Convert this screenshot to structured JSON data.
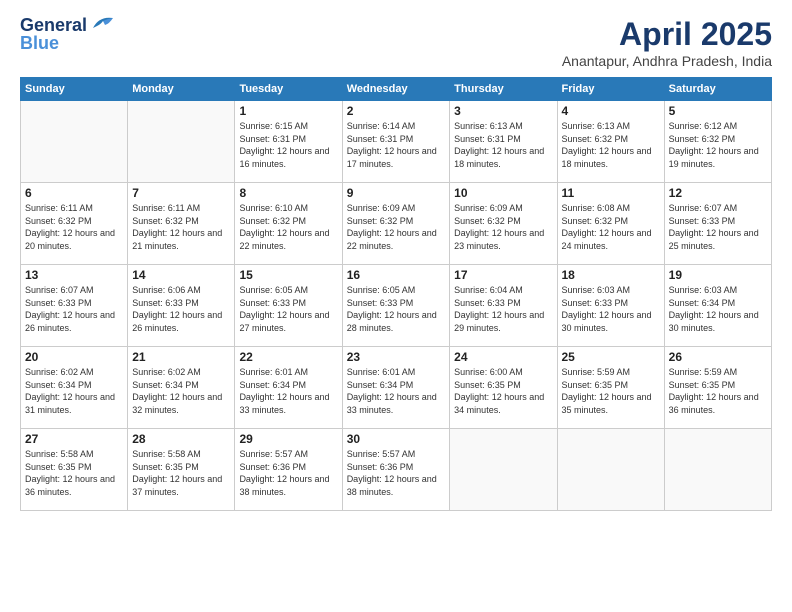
{
  "header": {
    "logo_line1": "General",
    "logo_line2": "Blue",
    "month_title": "April 2025",
    "location": "Anantapur, Andhra Pradesh, India"
  },
  "weekdays": [
    "Sunday",
    "Monday",
    "Tuesday",
    "Wednesday",
    "Thursday",
    "Friday",
    "Saturday"
  ],
  "weeks": [
    [
      {
        "day": "",
        "sunrise": "",
        "sunset": "",
        "daylight": ""
      },
      {
        "day": "",
        "sunrise": "",
        "sunset": "",
        "daylight": ""
      },
      {
        "day": "1",
        "sunrise": "Sunrise: 6:15 AM",
        "sunset": "Sunset: 6:31 PM",
        "daylight": "Daylight: 12 hours and 16 minutes."
      },
      {
        "day": "2",
        "sunrise": "Sunrise: 6:14 AM",
        "sunset": "Sunset: 6:31 PM",
        "daylight": "Daylight: 12 hours and 17 minutes."
      },
      {
        "day": "3",
        "sunrise": "Sunrise: 6:13 AM",
        "sunset": "Sunset: 6:31 PM",
        "daylight": "Daylight: 12 hours and 18 minutes."
      },
      {
        "day": "4",
        "sunrise": "Sunrise: 6:13 AM",
        "sunset": "Sunset: 6:32 PM",
        "daylight": "Daylight: 12 hours and 18 minutes."
      },
      {
        "day": "5",
        "sunrise": "Sunrise: 6:12 AM",
        "sunset": "Sunset: 6:32 PM",
        "daylight": "Daylight: 12 hours and 19 minutes."
      }
    ],
    [
      {
        "day": "6",
        "sunrise": "Sunrise: 6:11 AM",
        "sunset": "Sunset: 6:32 PM",
        "daylight": "Daylight: 12 hours and 20 minutes."
      },
      {
        "day": "7",
        "sunrise": "Sunrise: 6:11 AM",
        "sunset": "Sunset: 6:32 PM",
        "daylight": "Daylight: 12 hours and 21 minutes."
      },
      {
        "day": "8",
        "sunrise": "Sunrise: 6:10 AM",
        "sunset": "Sunset: 6:32 PM",
        "daylight": "Daylight: 12 hours and 22 minutes."
      },
      {
        "day": "9",
        "sunrise": "Sunrise: 6:09 AM",
        "sunset": "Sunset: 6:32 PM",
        "daylight": "Daylight: 12 hours and 22 minutes."
      },
      {
        "day": "10",
        "sunrise": "Sunrise: 6:09 AM",
        "sunset": "Sunset: 6:32 PM",
        "daylight": "Daylight: 12 hours and 23 minutes."
      },
      {
        "day": "11",
        "sunrise": "Sunrise: 6:08 AM",
        "sunset": "Sunset: 6:32 PM",
        "daylight": "Daylight: 12 hours and 24 minutes."
      },
      {
        "day": "12",
        "sunrise": "Sunrise: 6:07 AM",
        "sunset": "Sunset: 6:33 PM",
        "daylight": "Daylight: 12 hours and 25 minutes."
      }
    ],
    [
      {
        "day": "13",
        "sunrise": "Sunrise: 6:07 AM",
        "sunset": "Sunset: 6:33 PM",
        "daylight": "Daylight: 12 hours and 26 minutes."
      },
      {
        "day": "14",
        "sunrise": "Sunrise: 6:06 AM",
        "sunset": "Sunset: 6:33 PM",
        "daylight": "Daylight: 12 hours and 26 minutes."
      },
      {
        "day": "15",
        "sunrise": "Sunrise: 6:05 AM",
        "sunset": "Sunset: 6:33 PM",
        "daylight": "Daylight: 12 hours and 27 minutes."
      },
      {
        "day": "16",
        "sunrise": "Sunrise: 6:05 AM",
        "sunset": "Sunset: 6:33 PM",
        "daylight": "Daylight: 12 hours and 28 minutes."
      },
      {
        "day": "17",
        "sunrise": "Sunrise: 6:04 AM",
        "sunset": "Sunset: 6:33 PM",
        "daylight": "Daylight: 12 hours and 29 minutes."
      },
      {
        "day": "18",
        "sunrise": "Sunrise: 6:03 AM",
        "sunset": "Sunset: 6:33 PM",
        "daylight": "Daylight: 12 hours and 30 minutes."
      },
      {
        "day": "19",
        "sunrise": "Sunrise: 6:03 AM",
        "sunset": "Sunset: 6:34 PM",
        "daylight": "Daylight: 12 hours and 30 minutes."
      }
    ],
    [
      {
        "day": "20",
        "sunrise": "Sunrise: 6:02 AM",
        "sunset": "Sunset: 6:34 PM",
        "daylight": "Daylight: 12 hours and 31 minutes."
      },
      {
        "day": "21",
        "sunrise": "Sunrise: 6:02 AM",
        "sunset": "Sunset: 6:34 PM",
        "daylight": "Daylight: 12 hours and 32 minutes."
      },
      {
        "day": "22",
        "sunrise": "Sunrise: 6:01 AM",
        "sunset": "Sunset: 6:34 PM",
        "daylight": "Daylight: 12 hours and 33 minutes."
      },
      {
        "day": "23",
        "sunrise": "Sunrise: 6:01 AM",
        "sunset": "Sunset: 6:34 PM",
        "daylight": "Daylight: 12 hours and 33 minutes."
      },
      {
        "day": "24",
        "sunrise": "Sunrise: 6:00 AM",
        "sunset": "Sunset: 6:35 PM",
        "daylight": "Daylight: 12 hours and 34 minutes."
      },
      {
        "day": "25",
        "sunrise": "Sunrise: 5:59 AM",
        "sunset": "Sunset: 6:35 PM",
        "daylight": "Daylight: 12 hours and 35 minutes."
      },
      {
        "day": "26",
        "sunrise": "Sunrise: 5:59 AM",
        "sunset": "Sunset: 6:35 PM",
        "daylight": "Daylight: 12 hours and 36 minutes."
      }
    ],
    [
      {
        "day": "27",
        "sunrise": "Sunrise: 5:58 AM",
        "sunset": "Sunset: 6:35 PM",
        "daylight": "Daylight: 12 hours and 36 minutes."
      },
      {
        "day": "28",
        "sunrise": "Sunrise: 5:58 AM",
        "sunset": "Sunset: 6:35 PM",
        "daylight": "Daylight: 12 hours and 37 minutes."
      },
      {
        "day": "29",
        "sunrise": "Sunrise: 5:57 AM",
        "sunset": "Sunset: 6:36 PM",
        "daylight": "Daylight: 12 hours and 38 minutes."
      },
      {
        "day": "30",
        "sunrise": "Sunrise: 5:57 AM",
        "sunset": "Sunset: 6:36 PM",
        "daylight": "Daylight: 12 hours and 38 minutes."
      },
      {
        "day": "",
        "sunrise": "",
        "sunset": "",
        "daylight": ""
      },
      {
        "day": "",
        "sunrise": "",
        "sunset": "",
        "daylight": ""
      },
      {
        "day": "",
        "sunrise": "",
        "sunset": "",
        "daylight": ""
      }
    ]
  ]
}
